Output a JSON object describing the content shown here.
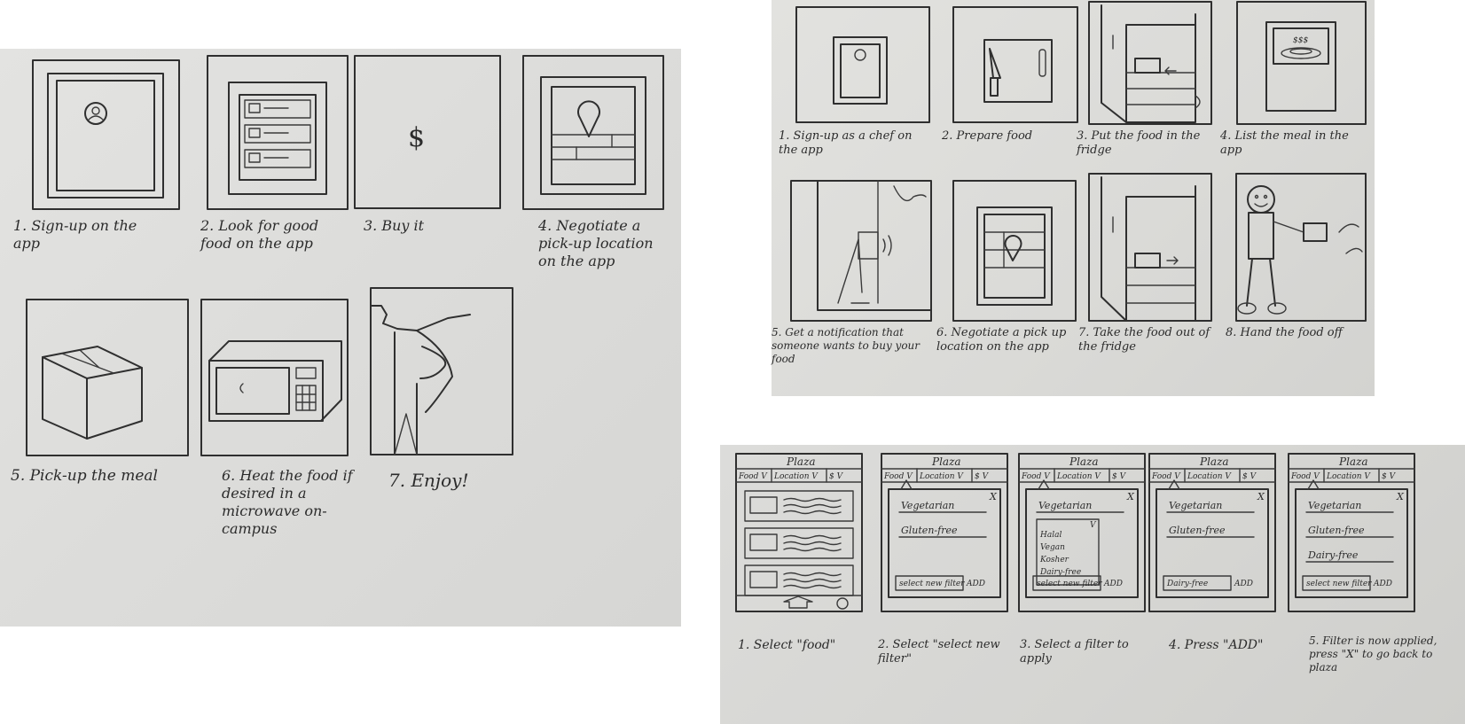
{
  "storyboard_buyer": {
    "captions": [
      "1. Sign-up on the app",
      "2. Look for good food on the app",
      "3. Buy it",
      "4. Negotiate a pick-up location on the app",
      "5. Pick-up the meal",
      "6. Heat the food if desired in a microwave on-campus",
      "7. Enjoy!"
    ],
    "dollar_sign": "$"
  },
  "storyboard_chef": {
    "captions": [
      "1. Sign-up as a chef on the app",
      "2. Prepare food",
      "3. Put the food in the fridge",
      "4. List the meal in the app",
      "5. Get a notification that someone wants to buy your food",
      "6. Negotiate a pick up location on the app",
      "7. Take the food out of the fridge",
      "8. Hand the food off"
    ],
    "price_mark": "$$$"
  },
  "storyboard_filter": {
    "captions": [
      "1. Select \"food\"",
      "2. Select \"select new filter\"",
      "3. Select a filter to apply",
      "4. Press \"ADD\"",
      "5. Filter is now applied, press \"X\" to go back to plaza"
    ],
    "app_title": "Plaza",
    "tabs": [
      "Food V",
      "Location V",
      "$ V"
    ],
    "close_label": "X",
    "select_label": "select new filter",
    "add_label": "ADD",
    "filters": {
      "vegetarian": "Vegetarian",
      "gluten_free": "Gluten-free",
      "dairy_free": "Dairy-free"
    },
    "dropdown_options": [
      "Halal",
      "Vegan",
      "Kosher",
      "Dairy-free"
    ],
    "dropdown_arrow": "V"
  },
  "colors": {
    "paper": "#dcdcda",
    "pencil": "#2f2f2f"
  }
}
